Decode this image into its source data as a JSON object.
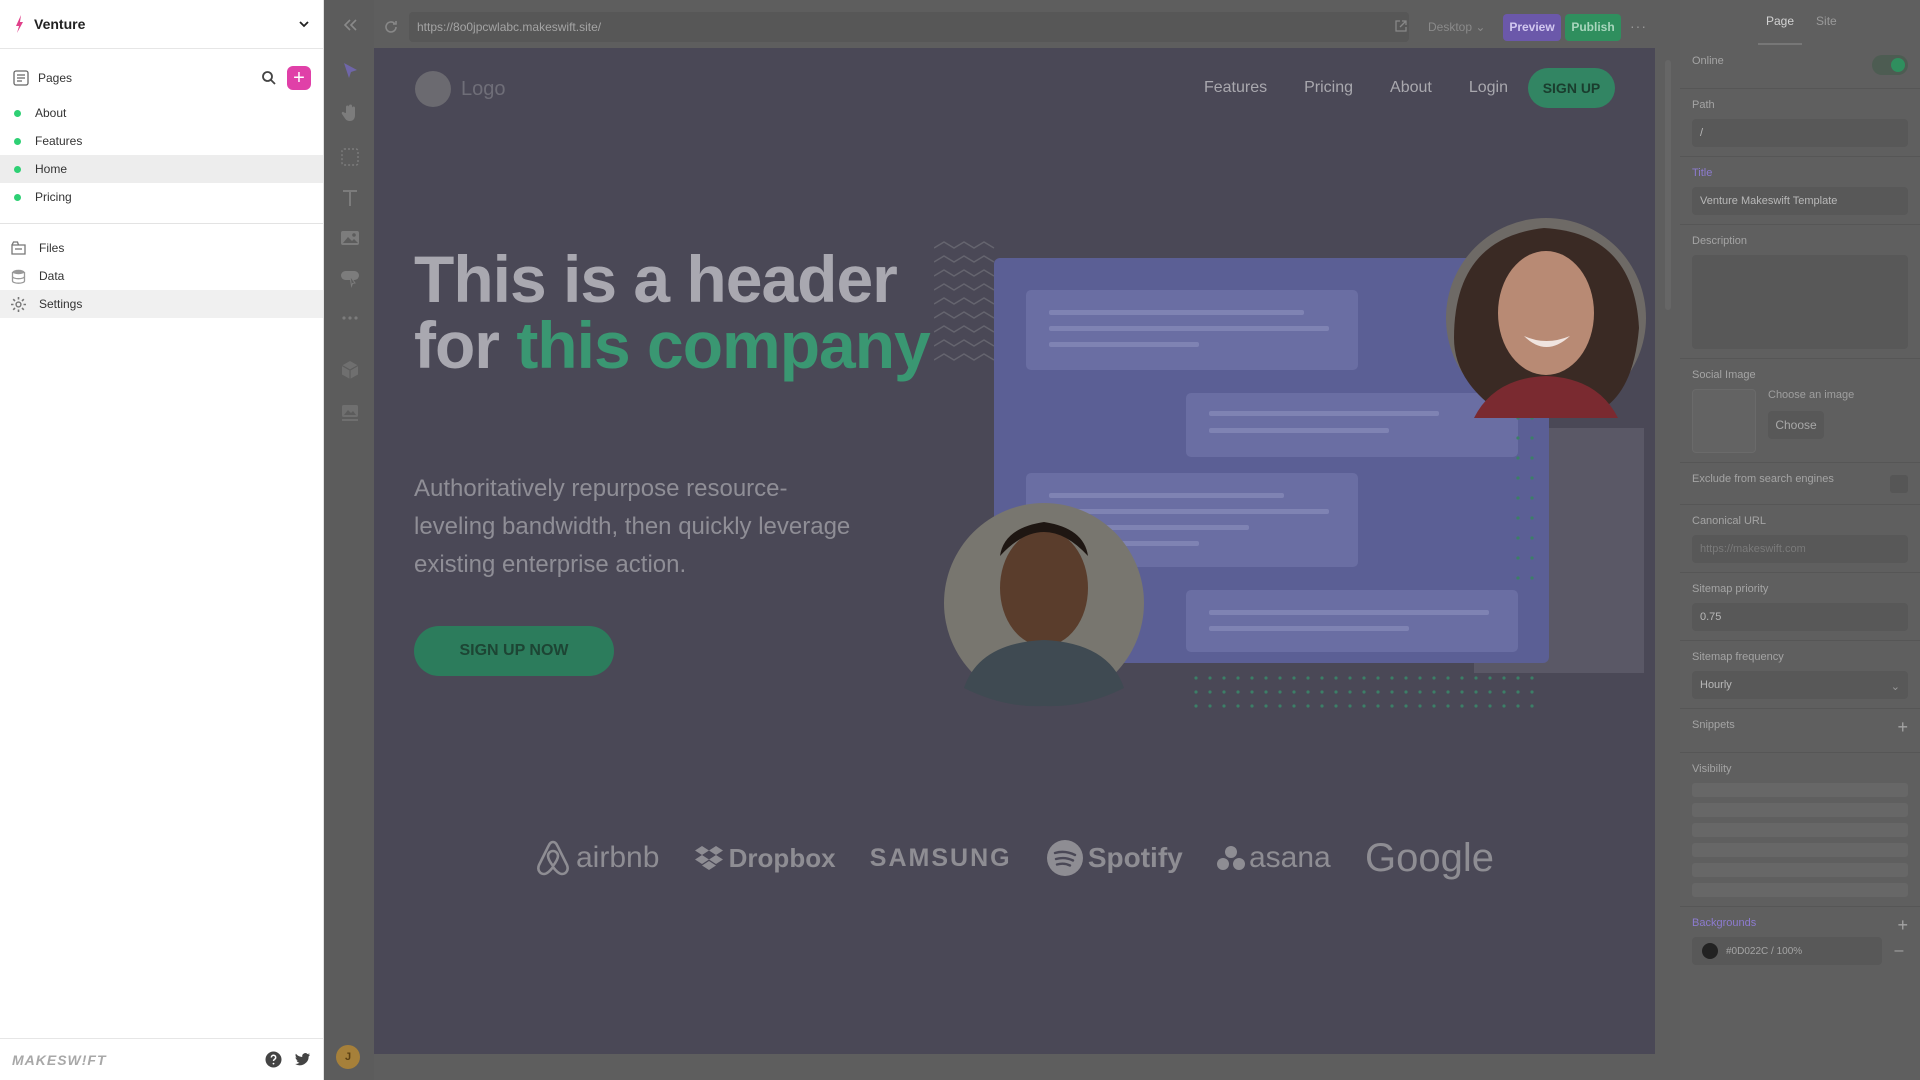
{
  "left_panel": {
    "site_name": "Venture",
    "pages_label": "Pages",
    "pages": [
      {
        "label": "About",
        "status_color": "#2ed074"
      },
      {
        "label": "Features",
        "status_color": "#2ed074"
      },
      {
        "label": "Home",
        "status_color": "#2ed074",
        "active": true
      },
      {
        "label": "Pricing",
        "status_color": "#2ed074"
      }
    ],
    "tools": [
      {
        "label": "Files",
        "icon": "files-icon"
      },
      {
        "label": "Data",
        "icon": "database-icon"
      },
      {
        "label": "Settings",
        "icon": "gear-icon"
      }
    ],
    "brand": "MAKESW!FT",
    "accent_color": "#e040a8"
  },
  "toolbar": {
    "url": "https://8o0jpcwlabc.makeswift.site/",
    "device": "Desktop",
    "preview_label": "Preview",
    "publish_label": "Publish"
  },
  "canvas": {
    "logo_text": "Logo",
    "nav": [
      "Features",
      "Pricing",
      "About",
      "Login"
    ],
    "nav_cta": "SIGN UP",
    "hero_title_plain": "This is a header for",
    "hero_title_accent": "this company",
    "hero_body": "Authoritatively repurpose resource-leveling bandwidth, then quickly leverage existing enterprise action.",
    "hero_cta": "SIGN UP NOW",
    "partner_logos": [
      "airbnb",
      "Dropbox",
      "SAMSUNG",
      "Spotify",
      "asana",
      "Google"
    ],
    "background_color": "#4a4856",
    "accent_color": "#3a9772"
  },
  "inspector": {
    "tabs": [
      "Page",
      "Site"
    ],
    "active_tab": "Page",
    "online_label": "Online",
    "online": true,
    "path_label": "Path",
    "path_value": "/",
    "title_label": "Title",
    "title_value": "Venture Makeswift Template",
    "description_label": "Description",
    "social_image_label": "Social Image",
    "social_image_hint": "Choose an image",
    "social_image_button": "Choose",
    "exclude_label": "Exclude from search engines",
    "canonical_label": "Canonical URL",
    "canonical_placeholder": "https://makeswift.com",
    "sitemap_priority_label": "Sitemap priority",
    "sitemap_priority_value": "0.75",
    "sitemap_frequency_label": "Sitemap frequency",
    "sitemap_frequency_value": "Hourly",
    "snippets_label": "Snippets",
    "visibility_label": "Visibility",
    "backgrounds_label": "Backgrounds",
    "background_value": "#0D022C / 100%"
  },
  "user_initial": "J"
}
